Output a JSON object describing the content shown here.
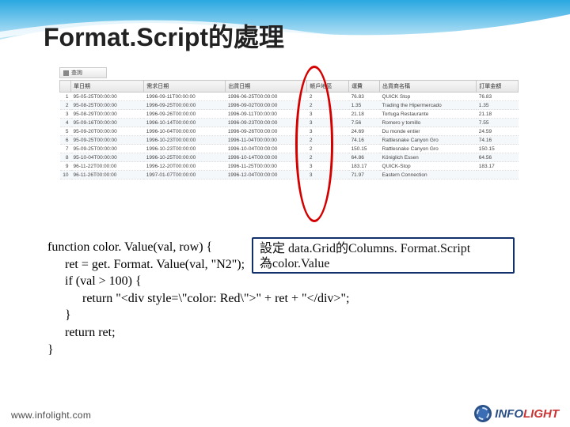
{
  "title": {
    "en": "Format.Script",
    "zh": "的處理"
  },
  "toolbar": {
    "label": "查詢"
  },
  "grid": {
    "headers": [
      "",
      "單日期",
      "需求日期",
      "出貨日期",
      "帳戶地區",
      "運費",
      "出貨商名稱",
      "訂單金額"
    ],
    "rows": [
      [
        "1",
        "95-05-25T00:00:00",
        "1996-09-11T00:00:00",
        "1996-06-25T00:00:00",
        "2",
        "76.83",
        "QUICK Stop",
        "76.83"
      ],
      [
        "2",
        "95-08-25T00:00:00",
        "1996-09-25T00:00:00",
        "1996-09-02T00:00:00",
        "2",
        "1.35",
        "Trading the Hipermercado",
        "1.35"
      ],
      [
        "3",
        "95-08-29T00:00:00",
        "1996-09-26T00:00:00",
        "1996-09-11T00:00:00",
        "3",
        "21.18",
        "Tortuga Restaurante",
        "21.18"
      ],
      [
        "4",
        "95-09-16T00:00:00",
        "1996-10-14T00:00:00",
        "1996-09-23T00:00:00",
        "3",
        "7.56",
        "Romero y tomillo",
        "7.55"
      ],
      [
        "5",
        "95-09-20T00:00:00",
        "1996-10-04T00:00:00",
        "1996-09-26T00:00:00",
        "3",
        "24.69",
        "Du monde entier",
        "24.59"
      ],
      [
        "6",
        "95-09-25T00:00:00",
        "1996-10-23T00:00:00",
        "1996-11-04T00:00:00",
        "2",
        "74.16",
        "Rattlesnake Canyon Gro",
        "74.16"
      ],
      [
        "7",
        "95-09-25T00:00:00",
        "1996-10-23T00:00:00",
        "1996-10-04T00:00:00",
        "2",
        "150.15",
        "Rattlesnake Canyon Gro",
        "150.15"
      ],
      [
        "8",
        "95-10-04T00:00:00",
        "1996-10-25T00:00:00",
        "1996-10-14T00:00:00",
        "2",
        "64.86",
        "Königlich Essen",
        "64.56"
      ],
      [
        "9",
        "96-11-22T00:00:00",
        "1996-12-20T00:00:00",
        "1996-11-25T00:00:00",
        "3",
        "183.17",
        "QUICK-Stop",
        "183.17"
      ],
      [
        "10",
        "96-11-26T00:00:00",
        "1997-01-07T00:00:00",
        "1996-12-04T00:00:00",
        "3",
        "71.97",
        "Eastern Connection",
        ""
      ]
    ]
  },
  "callout": {
    "line1": "設定 data.Grid的Columns. Format.Script",
    "line2": "為color.Value"
  },
  "code": {
    "l1": "function color. Value(val, row) {",
    "l2": "ret = get. Format. Value(val, \"N2\");",
    "l3": "if (val > 100) {",
    "l4": "return \"<div style=\\\"color: Red\\\">\" + ret + \"</div>\";",
    "l5": "}",
    "l6": "return ret;",
    "l7": "}"
  },
  "footer": {
    "url": "www.infolight.com",
    "brand1": "INFO",
    "brand2": "LIGHT"
  }
}
